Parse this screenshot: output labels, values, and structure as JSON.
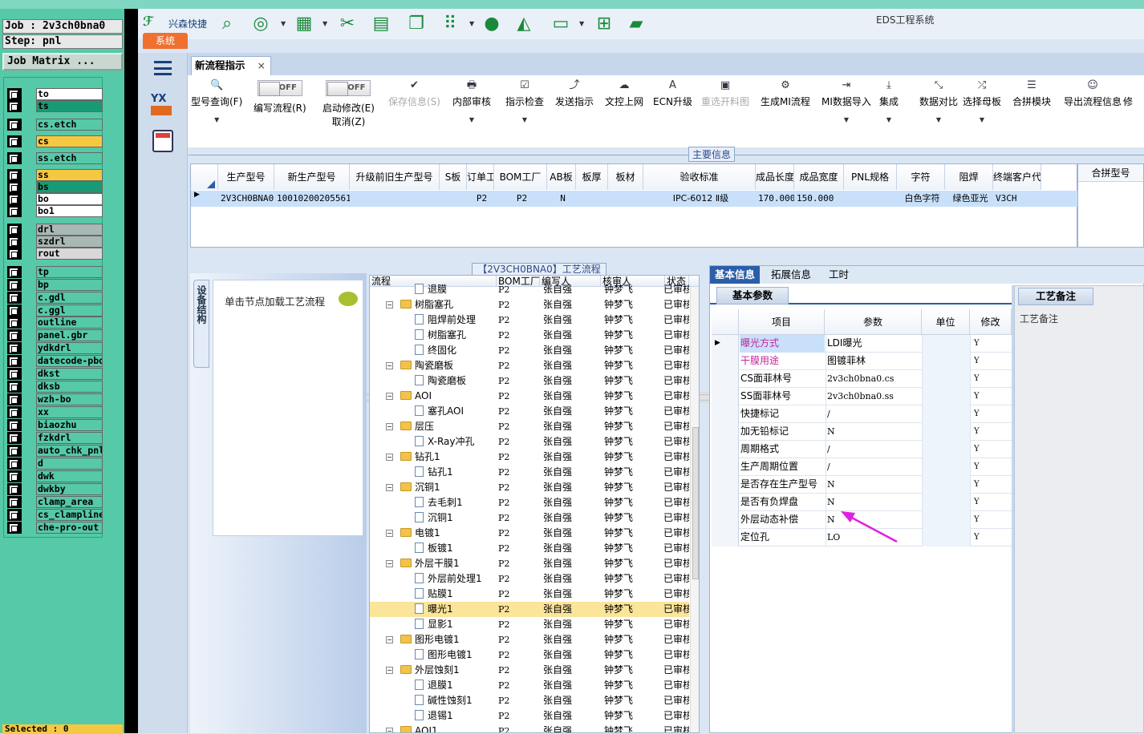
{
  "left_panel": {
    "job_line": "Job : 2v3ch0bna0",
    "step_line": "Step: pnl",
    "job_matrix_button": "Job Matrix ...",
    "layers": [
      {
        "name": "to",
        "color": "#ffffff"
      },
      {
        "name": "ts",
        "color": "#1a9a74"
      },
      {
        "name": "cs.etch",
        "color": "#55c9a8"
      },
      {
        "name": "cs",
        "color": "#f5c842"
      },
      {
        "name": "ss.etch",
        "color": "#55c9a8"
      },
      {
        "name": "ss",
        "color": "#f5c842"
      },
      {
        "name": "bs",
        "color": "#1a9a74"
      },
      {
        "name": "bo",
        "color": "#ffffff"
      },
      {
        "name": "bo1",
        "color": "#ffffff"
      },
      {
        "name": "drl",
        "color": "#a8b8b4"
      },
      {
        "name": "szdrl",
        "color": "#a8b8b4"
      },
      {
        "name": "rout",
        "color": "#d8d8d8"
      },
      {
        "name": "tp",
        "color": "#55c9a8"
      },
      {
        "name": "bp",
        "color": "#55c9a8"
      },
      {
        "name": "c.gdl",
        "color": "#55c9a8"
      },
      {
        "name": "c.ggl",
        "color": "#55c9a8"
      },
      {
        "name": "outline",
        "color": "#55c9a8"
      },
      {
        "name": "panel.gbr",
        "color": "#55c9a8"
      },
      {
        "name": "ydkdrl",
        "color": "#55c9a8"
      },
      {
        "name": "datecode-pbo",
        "color": "#55c9a8"
      },
      {
        "name": "dkst",
        "color": "#55c9a8"
      },
      {
        "name": "dksb",
        "color": "#55c9a8"
      },
      {
        "name": "wzh-bo",
        "color": "#55c9a8"
      },
      {
        "name": "xx",
        "color": "#55c9a8"
      },
      {
        "name": "biaozhu",
        "color": "#55c9a8"
      },
      {
        "name": "fzkdrl",
        "color": "#55c9a8"
      },
      {
        "name": "auto_chk_pnl",
        "color": "#55c9a8"
      },
      {
        "name": "d",
        "color": "#55c9a8"
      },
      {
        "name": "dwk",
        "color": "#55c9a8"
      },
      {
        "name": "dwkby",
        "color": "#55c9a8"
      },
      {
        "name": "clamp_area",
        "color": "#55c9a8"
      },
      {
        "name": "cs_clampline",
        "color": "#55c9a8"
      },
      {
        "name": "che-pro-out",
        "color": "#55c9a8"
      }
    ],
    "selected": "Selected : 0"
  },
  "app": {
    "title": "EDS工程系统",
    "brand": "兴森快捷",
    "system_tab": "系统",
    "doc_tab": "新流程指示",
    "doc_tab_close": "×"
  },
  "ribbon": {
    "items": [
      {
        "label": "型号查询(F)",
        "icon": "🔍",
        "dropdown": true,
        "disabled": false
      },
      {
        "label": "编写流程(R)",
        "toggle": "OFF",
        "disabled": false
      },
      {
        "label": "启动修改(E)",
        "label2": "取消(Z)",
        "toggle": "OFF",
        "disabled": false
      },
      {
        "label": "保存信息(S)",
        "icon": "✔",
        "disabled": true
      },
      {
        "label": "内部审核",
        "icon": "🖶",
        "dropdown": true,
        "disabled": false
      },
      {
        "label": "指示检查",
        "icon": "☑",
        "dropdown": true,
        "disabled": false
      },
      {
        "label": "发送指示",
        "icon": "⤴",
        "disabled": false
      },
      {
        "label": "文控上网",
        "icon": "☁",
        "disabled": false
      },
      {
        "label": "ECN升级",
        "icon": "A",
        "disabled": false
      },
      {
        "label": "重选开料图",
        "icon": "▣",
        "disabled": true
      },
      {
        "label": "生成MI流程",
        "icon": "⚙",
        "disabled": false
      },
      {
        "label": "MI数据导入",
        "icon": "⇥",
        "dropdown": true,
        "disabled": false
      },
      {
        "label": "集成",
        "icon": "⤓",
        "dropdown": true,
        "disabled": false
      },
      {
        "label": "数据对比",
        "icon": "⤡",
        "dropdown": true,
        "disabled": false
      },
      {
        "label": "选择母板",
        "icon": "⤮",
        "dropdown": true,
        "disabled": false
      },
      {
        "label": "合拼模块",
        "icon": "☰",
        "disabled": false
      },
      {
        "label": "导出流程信息",
        "icon": "☺",
        "disabled": false
      },
      {
        "label": "修",
        "icon": "",
        "disabled": false
      }
    ]
  },
  "main_info": {
    "section_label": "主要信息",
    "columns": [
      "生产型号",
      "新生产型号",
      "升级前旧生产型号",
      "S板",
      "订单工厂",
      "BOM工厂",
      "AB板",
      "板厚",
      "板材",
      "验收标准",
      "成品长度",
      "成品宽度",
      "PNL规格",
      "字符",
      "阻焊",
      "终端客户代码"
    ],
    "row": [
      "2V3CH0BNA0",
      "10010200205561",
      "",
      "",
      "P2",
      "P2",
      "N",
      "",
      "",
      "IPC-6012 Ⅱ级",
      "170.000",
      "150.000",
      "",
      "白色字符",
      "绿色亚光",
      "V3CH"
    ],
    "merge_header": "合拼型号"
  },
  "device_panel": {
    "tab_label": "设备结构",
    "hint": "单击节点加载工艺流程"
  },
  "flow": {
    "title": "【2V3CH0BNA0】工艺流程",
    "headers": [
      "流程",
      "BOM工厂",
      "编写人",
      "核审人",
      "状态"
    ],
    "rows": [
      {
        "name": "退膜",
        "level": 2,
        "type": "doc",
        "bom": "P2",
        "writer": "张自强",
        "reviewer": "钟梦飞",
        "status": "已审核"
      },
      {
        "name": "树脂塞孔",
        "level": 1,
        "type": "folder",
        "bom": "P2",
        "writer": "张自强",
        "reviewer": "钟梦飞",
        "status": "已审核"
      },
      {
        "name": "阻焊前处理",
        "level": 2,
        "type": "doc",
        "bom": "P2",
        "writer": "张自强",
        "reviewer": "钟梦飞",
        "status": "已审核"
      },
      {
        "name": "树脂塞孔",
        "level": 2,
        "type": "doc",
        "bom": "P2",
        "writer": "张自强",
        "reviewer": "钟梦飞",
        "status": "已审核"
      },
      {
        "name": "终固化",
        "level": 2,
        "type": "doc",
        "bom": "P2",
        "writer": "张自强",
        "reviewer": "钟梦飞",
        "status": "已审核"
      },
      {
        "name": "陶瓷磨板",
        "level": 1,
        "type": "folder",
        "bom": "P2",
        "writer": "张自强",
        "reviewer": "钟梦飞",
        "status": "已审核"
      },
      {
        "name": "陶瓷磨板",
        "level": 2,
        "type": "doc",
        "bom": "P2",
        "writer": "张自强",
        "reviewer": "钟梦飞",
        "status": "已审核"
      },
      {
        "name": "AOI",
        "level": 1,
        "type": "folder",
        "bom": "P2",
        "writer": "张自强",
        "reviewer": "钟梦飞",
        "status": "已审核"
      },
      {
        "name": "塞孔AOI",
        "level": 2,
        "type": "doc",
        "bom": "P2",
        "writer": "张自强",
        "reviewer": "钟梦飞",
        "status": "已审核"
      },
      {
        "name": "层压",
        "level": 1,
        "type": "folder",
        "bom": "P2",
        "writer": "张自强",
        "reviewer": "钟梦飞",
        "status": "已审核"
      },
      {
        "name": "X-Ray冲孔",
        "level": 2,
        "type": "doc",
        "bom": "P2",
        "writer": "张自强",
        "reviewer": "钟梦飞",
        "status": "已审核"
      },
      {
        "name": "钻孔1",
        "level": 1,
        "type": "folder",
        "bom": "P2",
        "writer": "张自强",
        "reviewer": "钟梦飞",
        "status": "已审核"
      },
      {
        "name": "钻孔1",
        "level": 2,
        "type": "doc",
        "bom": "P2",
        "writer": "张自强",
        "reviewer": "钟梦飞",
        "status": "已审核"
      },
      {
        "name": "沉铜1",
        "level": 1,
        "type": "folder",
        "bom": "P2",
        "writer": "张自强",
        "reviewer": "钟梦飞",
        "status": "已审核"
      },
      {
        "name": "去毛刺1",
        "level": 2,
        "type": "doc",
        "bom": "P2",
        "writer": "张自强",
        "reviewer": "钟梦飞",
        "status": "已审核"
      },
      {
        "name": "沉铜1",
        "level": 2,
        "type": "doc",
        "bom": "P2",
        "writer": "张自强",
        "reviewer": "钟梦飞",
        "status": "已审核"
      },
      {
        "name": "电镀1",
        "level": 1,
        "type": "folder",
        "bom": "P2",
        "writer": "张自强",
        "reviewer": "钟梦飞",
        "status": "已审核"
      },
      {
        "name": "板镀1",
        "level": 2,
        "type": "doc",
        "bom": "P2",
        "writer": "张自强",
        "reviewer": "钟梦飞",
        "status": "已审核"
      },
      {
        "name": "外层干膜1",
        "level": 1,
        "type": "folder",
        "bom": "P2",
        "writer": "张自强",
        "reviewer": "钟梦飞",
        "status": "已审核"
      },
      {
        "name": "外层前处理1",
        "level": 2,
        "type": "doc",
        "bom": "P2",
        "writer": "张自强",
        "reviewer": "钟梦飞",
        "status": "已审核"
      },
      {
        "name": "贴膜1",
        "level": 2,
        "type": "doc",
        "bom": "P2",
        "writer": "张自强",
        "reviewer": "钟梦飞",
        "status": "已审核"
      },
      {
        "name": "曝光1",
        "level": 2,
        "type": "doc",
        "bom": "P2",
        "writer": "张自强",
        "reviewer": "钟梦飞",
        "status": "已审核",
        "selected": true
      },
      {
        "name": "显影1",
        "level": 2,
        "type": "doc",
        "bom": "P2",
        "writer": "张自强",
        "reviewer": "钟梦飞",
        "status": "已审核"
      },
      {
        "name": "图形电镀1",
        "level": 1,
        "type": "folder",
        "bom": "P2",
        "writer": "张自强",
        "reviewer": "钟梦飞",
        "status": "已审核"
      },
      {
        "name": "图形电镀1",
        "level": 2,
        "type": "doc",
        "bom": "P2",
        "writer": "张自强",
        "reviewer": "钟梦飞",
        "status": "已审核"
      },
      {
        "name": "外层蚀刻1",
        "level": 1,
        "type": "folder",
        "bom": "P2",
        "writer": "张自强",
        "reviewer": "钟梦飞",
        "status": "已审核"
      },
      {
        "name": "退膜1",
        "level": 2,
        "type": "doc",
        "bom": "P2",
        "writer": "张自强",
        "reviewer": "钟梦飞",
        "status": "已审核"
      },
      {
        "name": "碱性蚀刻1",
        "level": 2,
        "type": "doc",
        "bom": "P2",
        "writer": "张自强",
        "reviewer": "钟梦飞",
        "status": "已审核"
      },
      {
        "name": "退锡1",
        "level": 2,
        "type": "doc",
        "bom": "P2",
        "writer": "张自强",
        "reviewer": "钟梦飞",
        "status": "已审核"
      },
      {
        "name": "AOI1",
        "level": 1,
        "type": "folder",
        "bom": "P2",
        "writer": "张自强",
        "reviewer": "钟梦飞",
        "status": "已审核"
      }
    ]
  },
  "info": {
    "tabs": [
      "基本信息",
      "拓展信息",
      "工时"
    ],
    "sub_tab": "基本参数",
    "columns": [
      "项目",
      "参数",
      "单位",
      "修改"
    ],
    "rows": [
      {
        "item": "曝光方式",
        "value": "LDI曝光",
        "unit": "",
        "edit": "Y",
        "pink": true,
        "current": true
      },
      {
        "item": "干膜用途",
        "value": "图镀菲林",
        "unit": "",
        "edit": "Y",
        "pink": true
      },
      {
        "item": "CS面菲林号",
        "value": "2v3ch0bna0.cs",
        "unit": "",
        "edit": "Y"
      },
      {
        "item": "SS面菲林号",
        "value": "2v3ch0bna0.ss",
        "unit": "",
        "edit": "Y"
      },
      {
        "item": "快捷标记",
        "value": "/",
        "unit": "",
        "edit": "Y"
      },
      {
        "item": "加无铅标记",
        "value": "N",
        "unit": "",
        "edit": "Y"
      },
      {
        "item": "周期格式",
        "value": "/",
        "unit": "",
        "edit": "Y"
      },
      {
        "item": "生产周期位置",
        "value": "/",
        "unit": "",
        "edit": "Y"
      },
      {
        "item": "是否存在生产型号",
        "value": "N",
        "unit": "",
        "edit": "Y"
      },
      {
        "item": "是否有负焊盘",
        "value": "N",
        "unit": "",
        "edit": "Y"
      },
      {
        "item": "外层动态补偿",
        "value": "N",
        "unit": "",
        "edit": "Y"
      },
      {
        "item": "定位孔",
        "value": "LO",
        "unit": "",
        "edit": "Y"
      }
    ]
  },
  "process_note": {
    "tab": "工艺备注",
    "label": "工艺备注"
  },
  "colors": {
    "accent": "#2a5ea8",
    "selection": "#fbe59a",
    "pink_text": "#c0269a",
    "annotation_arrow": "#e020e0"
  }
}
